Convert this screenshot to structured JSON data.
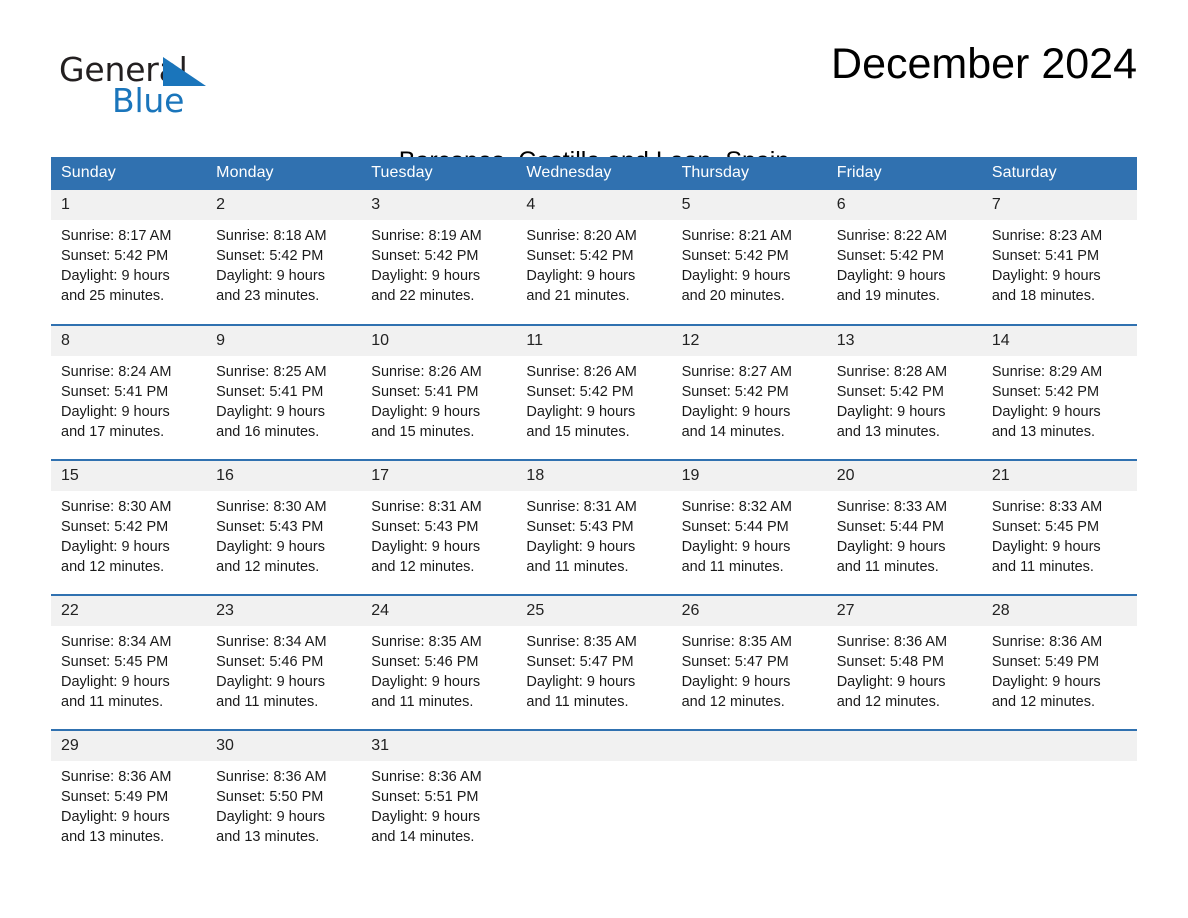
{
  "brand": {
    "name_part1": "General",
    "name_part2": "Blue",
    "triangle_color": "#1a75bb",
    "text_color": "#231f20"
  },
  "header": {
    "title": "December 2024",
    "subtitle": "Barcones, Castille and Leon, Spain"
  },
  "colors": {
    "header_blue": "#3071b0",
    "row_divider_blue": "#3071b0",
    "daynum_band": "#f1f1f1",
    "page_background": "#ffffff",
    "body_text": "#1a1a1a"
  },
  "calendar": {
    "weekday_headers": [
      "Sunday",
      "Monday",
      "Tuesday",
      "Wednesday",
      "Thursday",
      "Friday",
      "Saturday"
    ],
    "weeks": [
      [
        {
          "day": "1",
          "info": "Sunrise: 8:17 AM\nSunset: 5:42 PM\nDaylight: 9 hours and 25 minutes."
        },
        {
          "day": "2",
          "info": "Sunrise: 8:18 AM\nSunset: 5:42 PM\nDaylight: 9 hours and 23 minutes."
        },
        {
          "day": "3",
          "info": "Sunrise: 8:19 AM\nSunset: 5:42 PM\nDaylight: 9 hours and 22 minutes."
        },
        {
          "day": "4",
          "info": "Sunrise: 8:20 AM\nSunset: 5:42 PM\nDaylight: 9 hours and 21 minutes."
        },
        {
          "day": "5",
          "info": "Sunrise: 8:21 AM\nSunset: 5:42 PM\nDaylight: 9 hours and 20 minutes."
        },
        {
          "day": "6",
          "info": "Sunrise: 8:22 AM\nSunset: 5:42 PM\nDaylight: 9 hours and 19 minutes."
        },
        {
          "day": "7",
          "info": "Sunrise: 8:23 AM\nSunset: 5:41 PM\nDaylight: 9 hours and 18 minutes."
        }
      ],
      [
        {
          "day": "8",
          "info": "Sunrise: 8:24 AM\nSunset: 5:41 PM\nDaylight: 9 hours and 17 minutes."
        },
        {
          "day": "9",
          "info": "Sunrise: 8:25 AM\nSunset: 5:41 PM\nDaylight: 9 hours and 16 minutes."
        },
        {
          "day": "10",
          "info": "Sunrise: 8:26 AM\nSunset: 5:41 PM\nDaylight: 9 hours and 15 minutes."
        },
        {
          "day": "11",
          "info": "Sunrise: 8:26 AM\nSunset: 5:42 PM\nDaylight: 9 hours and 15 minutes."
        },
        {
          "day": "12",
          "info": "Sunrise: 8:27 AM\nSunset: 5:42 PM\nDaylight: 9 hours and 14 minutes."
        },
        {
          "day": "13",
          "info": "Sunrise: 8:28 AM\nSunset: 5:42 PM\nDaylight: 9 hours and 13 minutes."
        },
        {
          "day": "14",
          "info": "Sunrise: 8:29 AM\nSunset: 5:42 PM\nDaylight: 9 hours and 13 minutes."
        }
      ],
      [
        {
          "day": "15",
          "info": "Sunrise: 8:30 AM\nSunset: 5:42 PM\nDaylight: 9 hours and 12 minutes."
        },
        {
          "day": "16",
          "info": "Sunrise: 8:30 AM\nSunset: 5:43 PM\nDaylight: 9 hours and 12 minutes."
        },
        {
          "day": "17",
          "info": "Sunrise: 8:31 AM\nSunset: 5:43 PM\nDaylight: 9 hours and 12 minutes."
        },
        {
          "day": "18",
          "info": "Sunrise: 8:31 AM\nSunset: 5:43 PM\nDaylight: 9 hours and 11 minutes."
        },
        {
          "day": "19",
          "info": "Sunrise: 8:32 AM\nSunset: 5:44 PM\nDaylight: 9 hours and 11 minutes."
        },
        {
          "day": "20",
          "info": "Sunrise: 8:33 AM\nSunset: 5:44 PM\nDaylight: 9 hours and 11 minutes."
        },
        {
          "day": "21",
          "info": "Sunrise: 8:33 AM\nSunset: 5:45 PM\nDaylight: 9 hours and 11 minutes."
        }
      ],
      [
        {
          "day": "22",
          "info": "Sunrise: 8:34 AM\nSunset: 5:45 PM\nDaylight: 9 hours and 11 minutes."
        },
        {
          "day": "23",
          "info": "Sunrise: 8:34 AM\nSunset: 5:46 PM\nDaylight: 9 hours and 11 minutes."
        },
        {
          "day": "24",
          "info": "Sunrise: 8:35 AM\nSunset: 5:46 PM\nDaylight: 9 hours and 11 minutes."
        },
        {
          "day": "25",
          "info": "Sunrise: 8:35 AM\nSunset: 5:47 PM\nDaylight: 9 hours and 11 minutes."
        },
        {
          "day": "26",
          "info": "Sunrise: 8:35 AM\nSunset: 5:47 PM\nDaylight: 9 hours and 12 minutes."
        },
        {
          "day": "27",
          "info": "Sunrise: 8:36 AM\nSunset: 5:48 PM\nDaylight: 9 hours and 12 minutes."
        },
        {
          "day": "28",
          "info": "Sunrise: 8:36 AM\nSunset: 5:49 PM\nDaylight: 9 hours and 12 minutes."
        }
      ],
      [
        {
          "day": "29",
          "info": "Sunrise: 8:36 AM\nSunset: 5:49 PM\nDaylight: 9 hours and 13 minutes."
        },
        {
          "day": "30",
          "info": "Sunrise: 8:36 AM\nSunset: 5:50 PM\nDaylight: 9 hours and 13 minutes."
        },
        {
          "day": "31",
          "info": "Sunrise: 8:36 AM\nSunset: 5:51 PM\nDaylight: 9 hours and 14 minutes."
        },
        {
          "day": "",
          "info": ""
        },
        {
          "day": "",
          "info": ""
        },
        {
          "day": "",
          "info": ""
        },
        {
          "day": "",
          "info": ""
        }
      ]
    ]
  }
}
